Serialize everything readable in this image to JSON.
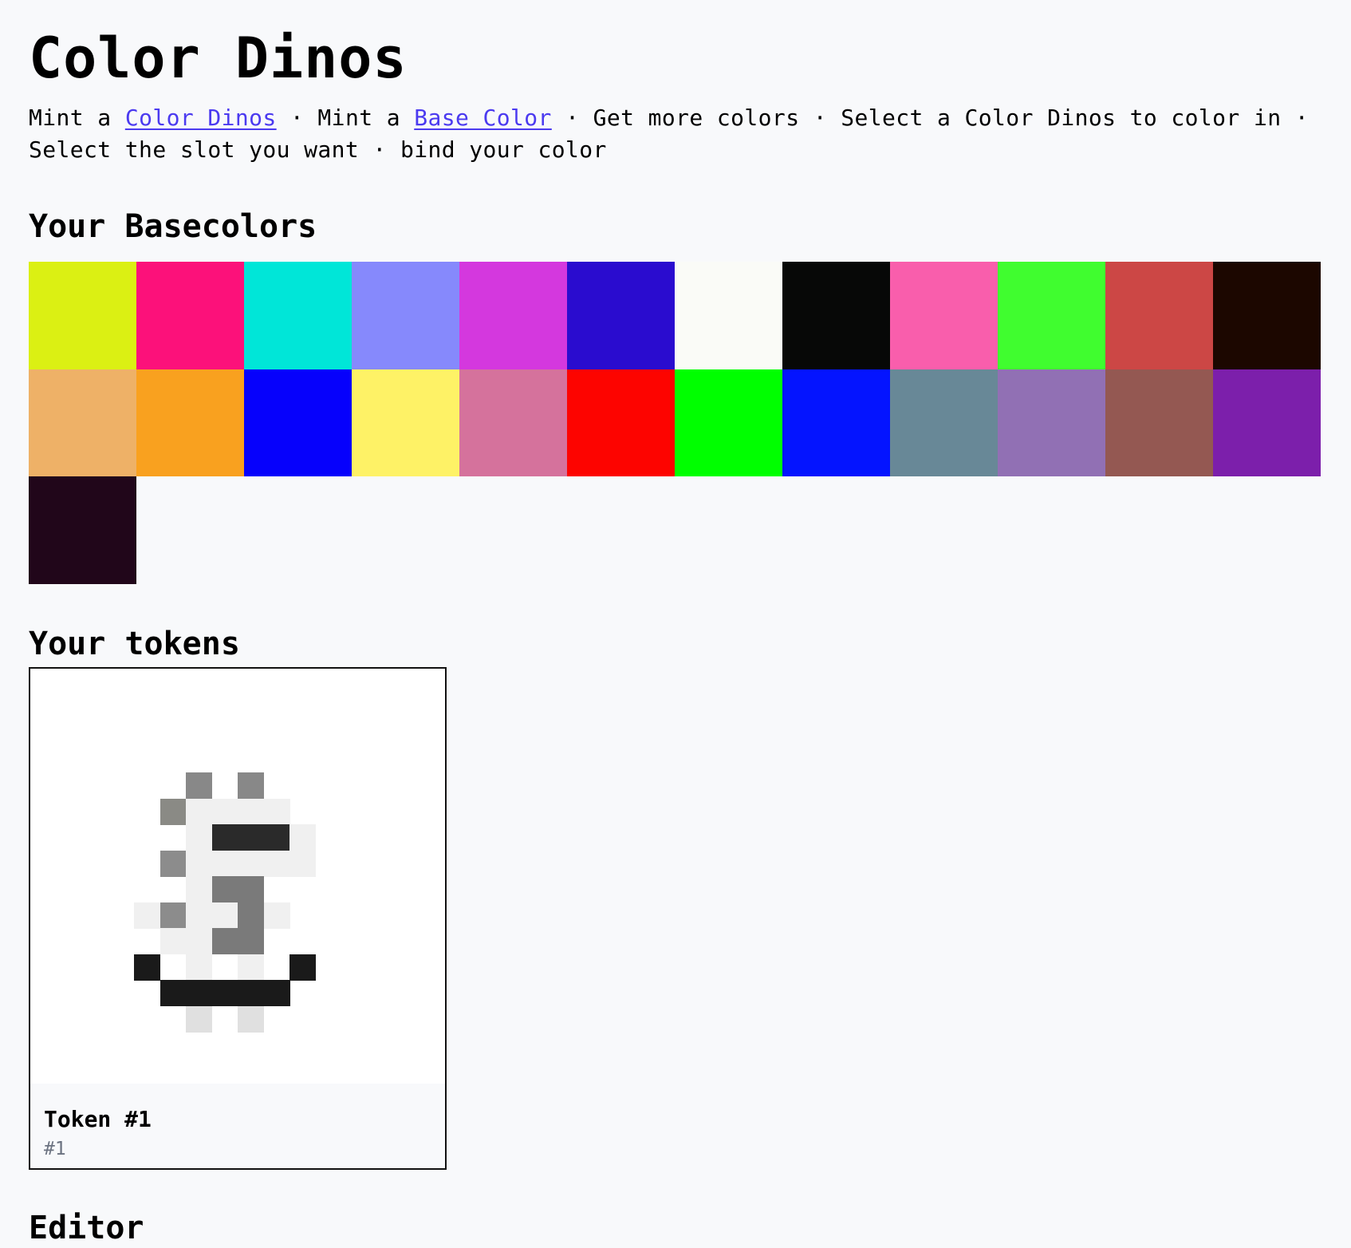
{
  "title": "Color Dinos",
  "intro": {
    "part1": "Mint a ",
    "link1": "Color Dinos",
    "part2": " · Mint a ",
    "link2": "Base Color",
    "part3": " · Get more colors · Select a Color Dinos to color in · Select the slot you want · bind your color"
  },
  "basecolors": {
    "heading": "Your Basecolors",
    "colors": [
      "#dbf013",
      "#fc117a",
      "#00e6d8",
      "#8689fc",
      "#d438de",
      "#2a0ccf",
      "#fafbf7",
      "#070807",
      "#f95eac",
      "#40fd2f",
      "#cc4745",
      "#1c0700",
      "#eeb167",
      "#f9a11f",
      "#0601fc",
      "#fef266",
      "#d5729c",
      "#fd0400",
      "#00ff00",
      "#0414ff",
      "#688897",
      "#9170b4",
      "#945852",
      "#7c1fab",
      "#21061a"
    ]
  },
  "tokens": {
    "heading": "Your tokens",
    "items": [
      {
        "name": "Token #1",
        "id": "#1"
      }
    ]
  },
  "editor": {
    "heading": "Editor"
  }
}
